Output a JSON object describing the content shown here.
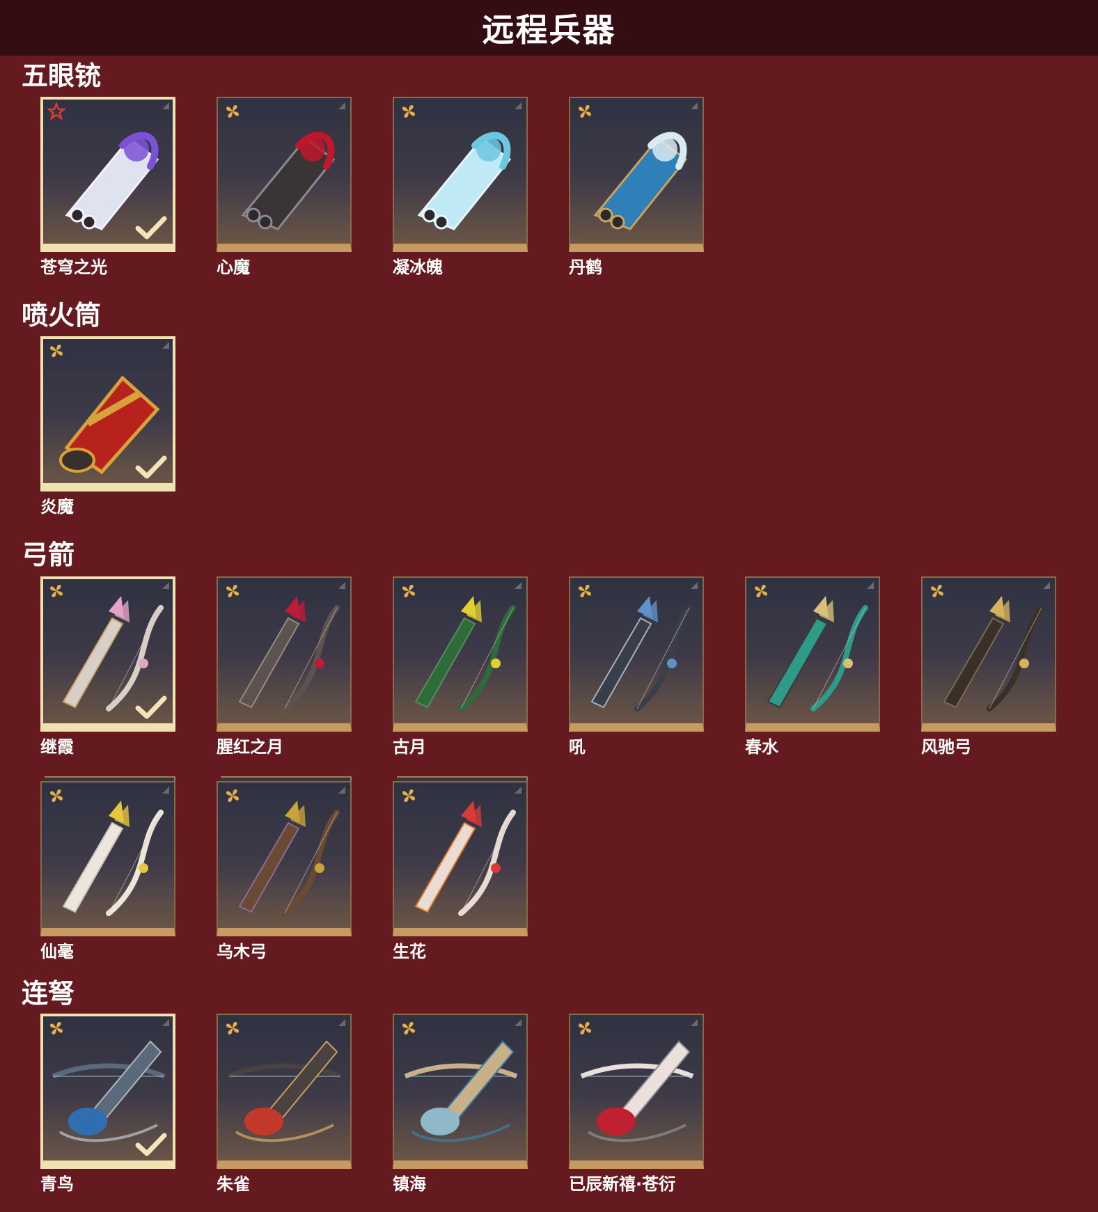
{
  "page_title": "远程兵器",
  "colors": {
    "background": "#651a1f",
    "header_bg": "#330d11",
    "card_border": "#c79a62",
    "selected_border": "#f1e0b0"
  },
  "sections": [
    {
      "title": "五眼铳",
      "items": [
        {
          "name": "苍穹之光",
          "rarity_icon": "red-flower-icon",
          "selected": true
        },
        {
          "name": "心魔",
          "rarity_icon": "gold-flower-icon",
          "selected": false
        },
        {
          "name": "凝冰魄",
          "rarity_icon": "gold-flower-icon",
          "selected": false
        },
        {
          "name": "丹鹤",
          "rarity_icon": "gold-flower-icon",
          "selected": false
        }
      ]
    },
    {
      "title": "喷火筒",
      "items": [
        {
          "name": "炎魔",
          "rarity_icon": "gold-flower-icon",
          "selected": true
        }
      ]
    },
    {
      "title": "弓箭",
      "items": [
        {
          "name": "继霞",
          "rarity_icon": "gold-flower-icon",
          "selected": true
        },
        {
          "name": "腥红之月",
          "rarity_icon": "gold-flower-icon",
          "selected": false
        },
        {
          "name": "古月",
          "rarity_icon": "gold-flower-icon",
          "selected": false
        },
        {
          "name": "吼",
          "rarity_icon": "gold-flower-icon",
          "selected": false
        },
        {
          "name": "春水",
          "rarity_icon": "gold-flower-icon",
          "selected": false
        },
        {
          "name": "风驰弓",
          "rarity_icon": "gold-flower-icon",
          "selected": false
        },
        {
          "name": "仙毫",
          "rarity_icon": "gold-flower-icon",
          "selected": false
        },
        {
          "name": "乌木弓",
          "rarity_icon": "gold-flower-icon",
          "selected": false
        },
        {
          "name": "生花",
          "rarity_icon": "gold-flower-icon",
          "selected": false
        }
      ]
    },
    {
      "title": "连弩",
      "items": [
        {
          "name": "青鸟",
          "rarity_icon": "gold-flower-icon",
          "selected": true
        },
        {
          "name": "朱雀",
          "rarity_icon": "gold-flower-icon",
          "selected": false
        },
        {
          "name": "镇海",
          "rarity_icon": "gold-flower-icon",
          "selected": false
        },
        {
          "name": "已辰新禧·苍衍",
          "rarity_icon": "gold-flower-icon",
          "selected": false
        }
      ]
    }
  ]
}
